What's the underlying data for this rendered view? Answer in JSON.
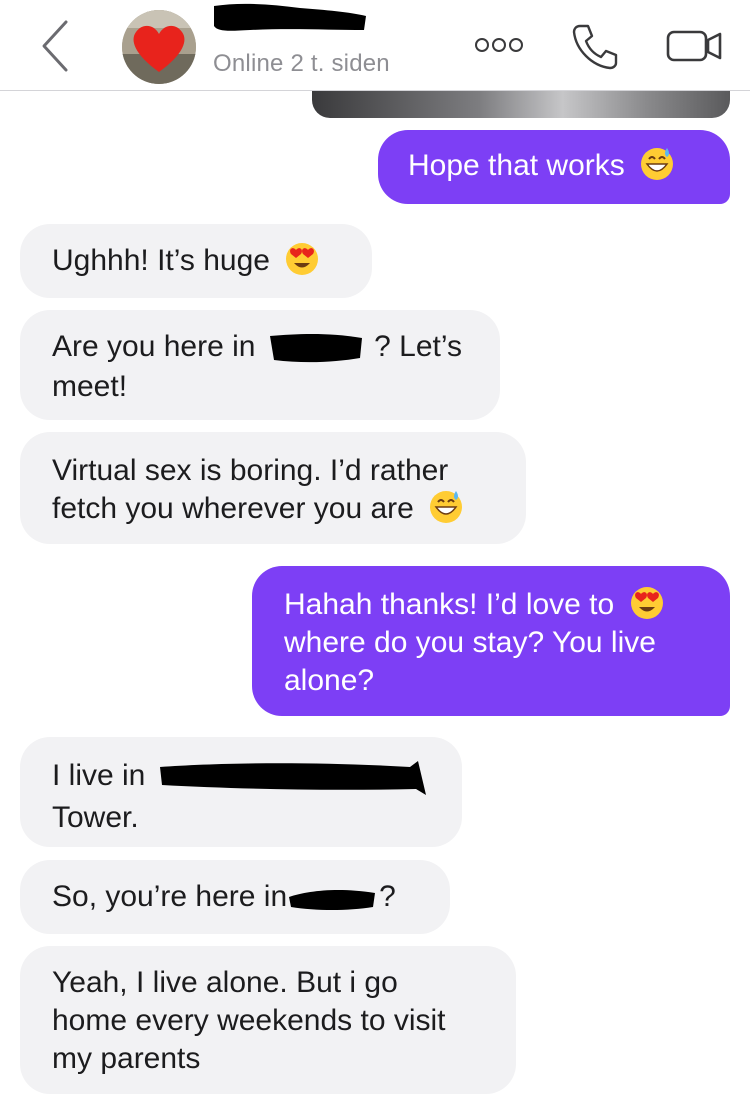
{
  "header": {
    "status": "Online 2 t. siden"
  },
  "messages": [
    {
      "dir": "out",
      "text": "Hope that works"
    },
    {
      "dir": "in",
      "text": "Ughhh! It’s huge"
    },
    {
      "dir": "in",
      "line1_a": "Are you here in",
      "line1_b": "? Let’s",
      "line2": "meet!"
    },
    {
      "dir": "in",
      "line1": "Virtual sex is boring. I’d rather",
      "line2": "fetch you wherever you are"
    },
    {
      "dir": "out",
      "line1": "Hahah thanks! I’d love to",
      "line2": "where do you stay? You live",
      "line3": "alone?"
    },
    {
      "dir": "in",
      "line1": "I live in",
      "line2": "Tower."
    },
    {
      "dir": "in",
      "text_a": "So, you’re here in",
      "text_b": "?"
    },
    {
      "dir": "in",
      "line1": "Yeah, I live alone. But i go",
      "line2": "home every weekends to visit",
      "line3": "my parents"
    }
  ],
  "colors": {
    "outgoing_bubble": "#7d3ff5",
    "incoming_bubble": "#f2f2f4",
    "status_text": "#8e8e93"
  },
  "icons": [
    "back-chevron-icon",
    "avatar-heart-icon",
    "more-options-icon",
    "phone-icon",
    "video-camera-icon",
    "grinning-sweat-emoji",
    "heart-eyes-emoji"
  ]
}
